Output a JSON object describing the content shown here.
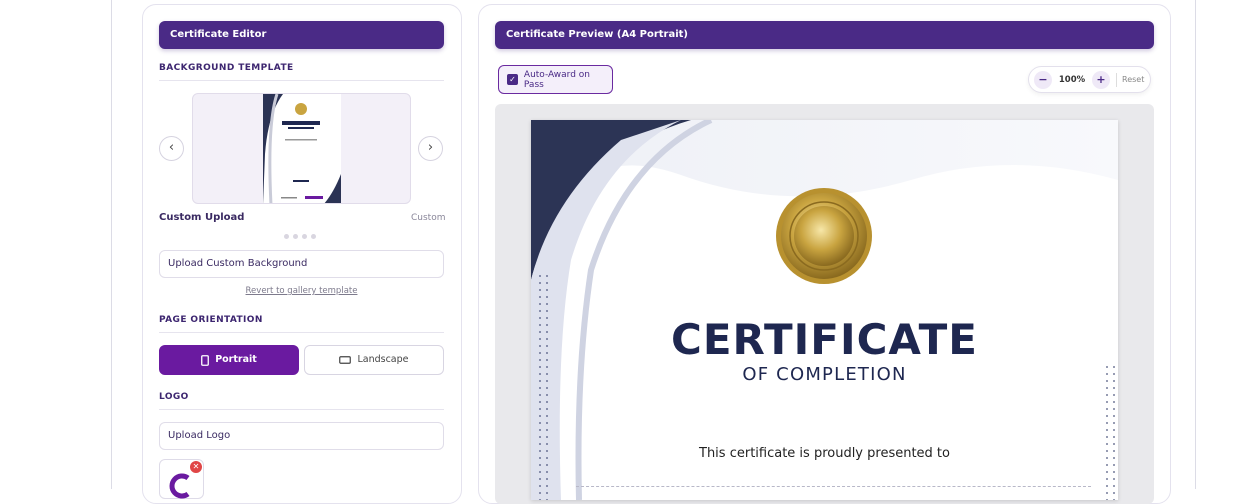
{
  "editor": {
    "header": "Certificate Editor",
    "background_template": {
      "title": "BACKGROUND TEMPLATE",
      "prev_icon": "chevron-left-icon",
      "next_icon": "chevron-right-icon",
      "template_name": "Custom Upload",
      "template_tag": "Custom",
      "upload_button": "Upload Custom Background",
      "revert_link": "Revert to gallery template"
    },
    "page_orientation": {
      "title": "PAGE ORIENTATION",
      "options": [
        "Portrait",
        "Landscape"
      ],
      "selected": "Portrait"
    },
    "logo": {
      "title": "LOGO",
      "upload_button": "Upload Logo"
    }
  },
  "preview": {
    "header": "Certificate Preview (A4 Portrait)",
    "auto_award_label": "Auto-Award on Pass",
    "auto_award_checked": true,
    "zoom": {
      "minus": "−",
      "value": "100%",
      "plus": "+",
      "reset": "Reset"
    },
    "certificate": {
      "title": "CERTIFICATE",
      "subtitle": "OF COMPLETION",
      "presented_text": "This certificate is proudly presented to"
    }
  },
  "colors": {
    "accent": "#4a2a86",
    "active_button": "#6a1aa0",
    "navy": "#1e2750",
    "gold": "#c9a440"
  }
}
